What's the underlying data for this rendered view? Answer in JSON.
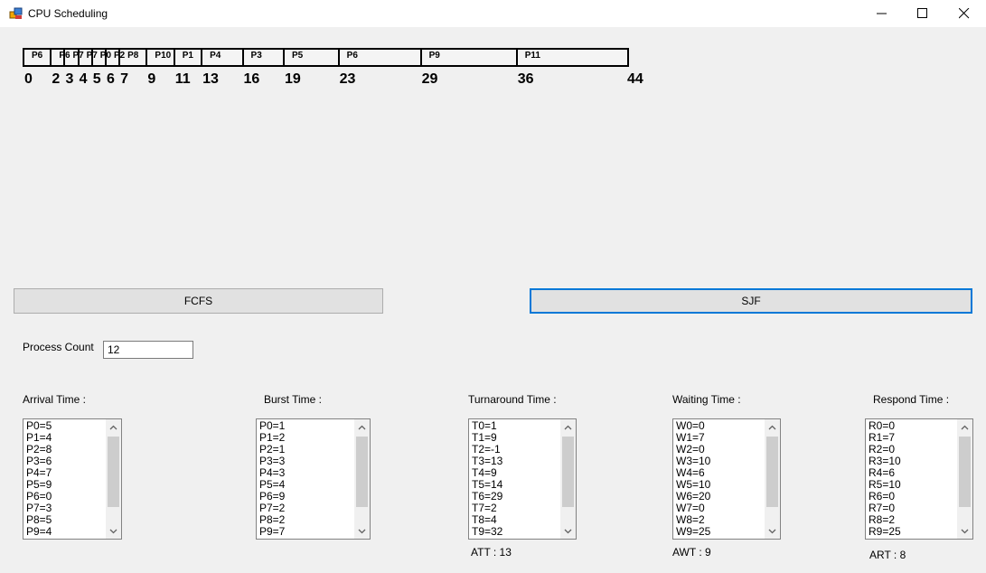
{
  "window": {
    "title": "CPU Scheduling"
  },
  "gantt": {
    "segments": [
      {
        "label": "P6",
        "start": 0,
        "end": 2
      },
      {
        "label": "P6",
        "start": 2,
        "end": 3
      },
      {
        "label": "P7",
        "start": 3,
        "end": 4
      },
      {
        "label": "P7",
        "start": 4,
        "end": 5
      },
      {
        "label": "P0",
        "start": 5,
        "end": 6
      },
      {
        "label": "P2",
        "start": 6,
        "end": 7
      },
      {
        "label": "P8",
        "start": 7,
        "end": 9
      },
      {
        "label": "P10",
        "start": 9,
        "end": 11
      },
      {
        "label": "P1",
        "start": 11,
        "end": 13
      },
      {
        "label": "P4",
        "start": 13,
        "end": 16
      },
      {
        "label": "P3",
        "start": 16,
        "end": 19
      },
      {
        "label": "P5",
        "start": 19,
        "end": 23
      },
      {
        "label": "P6",
        "start": 23,
        "end": 29
      },
      {
        "label": "P9",
        "start": 29,
        "end": 36
      },
      {
        "label": "P11",
        "start": 36,
        "end": 44
      }
    ],
    "ticks": [
      "0",
      "2",
      "3",
      "4",
      "5",
      "6",
      "7",
      "9",
      "11",
      "13",
      "16",
      "19",
      "23",
      "29",
      "36",
      "44"
    ]
  },
  "buttons": {
    "fcfs": "FCFS",
    "sjf": "SJF"
  },
  "process_count": {
    "label": "Process Count",
    "value": "12"
  },
  "lists": {
    "arrival": {
      "header": "Arrival Time :",
      "items": [
        "P0=5",
        "P1=4",
        "P2=8",
        "P3=6",
        "P4=7",
        "P5=9",
        "P6=0",
        "P7=3",
        "P8=5",
        "P9=4"
      ]
    },
    "burst": {
      "header": "Burst Time :",
      "items": [
        "P0=1",
        "P1=2",
        "P2=1",
        "P3=3",
        "P4=3",
        "P5=4",
        "P6=9",
        "P7=2",
        "P8=2",
        "P9=7"
      ]
    },
    "turnaround": {
      "header": "Turnaround Time :",
      "items": [
        "T0=1",
        "T1=9",
        "T2=-1",
        "T3=13",
        "T4=9",
        "T5=14",
        "T6=29",
        "T7=2",
        "T8=4",
        "T9=32"
      ],
      "summary": "ATT : 13"
    },
    "waiting": {
      "header": "Waiting Time :",
      "items": [
        "W0=0",
        "W1=7",
        "W2=0",
        "W3=10",
        "W4=6",
        "W5=10",
        "W6=20",
        "W7=0",
        "W8=2",
        "W9=25"
      ],
      "summary": "AWT : 9"
    },
    "respond": {
      "header": "Respond Time :",
      "items": [
        "R0=0",
        "R1=7",
        "R2=0",
        "R3=10",
        "R4=6",
        "R5=10",
        "R6=0",
        "R7=0",
        "R8=2",
        "R9=25"
      ],
      "summary": "ART : 8"
    }
  },
  "colors": {
    "accent": "#0078d7",
    "window_bg": "#f0f0f0"
  }
}
